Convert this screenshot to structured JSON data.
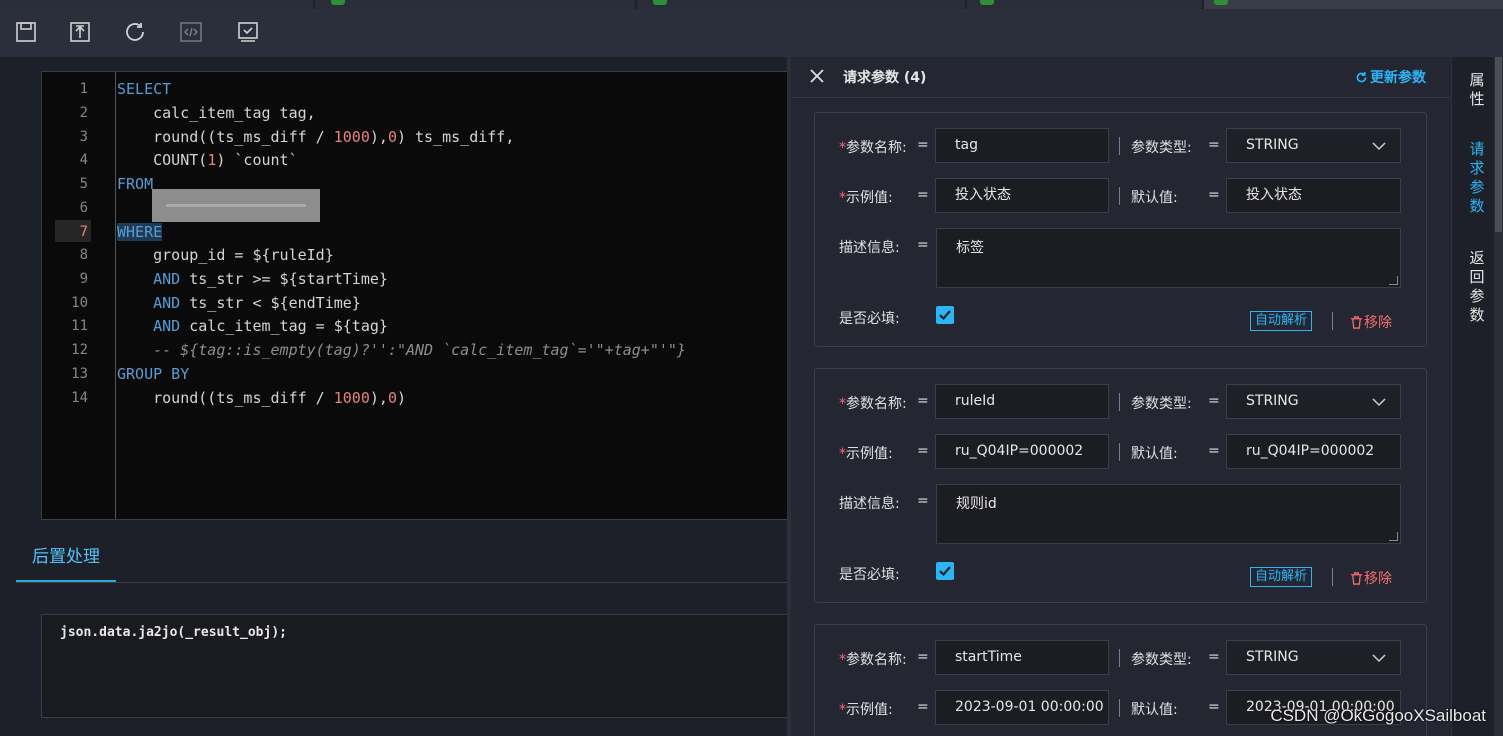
{
  "toolbar": {
    "buttons": [
      {
        "name": "save-icon"
      },
      {
        "name": "export-icon"
      },
      {
        "name": "refresh-icon"
      },
      {
        "name": "code-icon"
      },
      {
        "name": "checklist-icon"
      }
    ]
  },
  "editor": {
    "line_numbers": [
      "1",
      "2",
      "3",
      "4",
      "5",
      "6",
      "7",
      "8",
      "9",
      "10",
      "11",
      "12",
      "13",
      "14"
    ],
    "current_line": "7",
    "lines": {
      "l1": "SELECT",
      "l2": "    calc_item_tag tag,",
      "l3a": "    round((ts_ms_diff / ",
      "l3n1": "1000",
      "l3b": "),",
      "l3n2": "0",
      "l3c": ") ts_ms_diff,",
      "l4a": "    COUNT(",
      "l4n": "1",
      "l4b": ") `count`",
      "l5": "FROM",
      "l7": "WHERE",
      "l8": "    group_id = ${ruleId}",
      "l9k": "AND",
      "l9": " ts_str >= ${startTime}",
      "l10k": "AND",
      "l10": " ts_str < ${endTime}",
      "l11k": "AND",
      "l11": " calc_item_tag = ${tag}",
      "l12": "    -- ${tag::is_empty(tag)?'':\"AND `calc_item_tag`='\"+tag+\"'\"}",
      "l13": "GROUP BY",
      "l14a": "    round((ts_ms_diff / ",
      "l14n1": "1000",
      "l14b": "),",
      "l14n2": "0",
      "l14c": ")"
    }
  },
  "post": {
    "tab_label": "后置处理",
    "code": "json.data.ja2jo(_result_obj);"
  },
  "panel": {
    "title": "请求参数 (4)",
    "refresh_label": "更新参数",
    "labels": {
      "param_name": "参数名称:",
      "param_type": "参数类型:",
      "example": "示例值:",
      "default": "默认值:",
      "desc": "描述信息:",
      "required": "是否必填:",
      "eq": "=",
      "req_mark": "*",
      "auto_parse": "自动解析",
      "remove": "移除"
    },
    "params": [
      {
        "name": "tag",
        "type": "STRING",
        "example": "投入状态",
        "default": "投入状态",
        "desc": "标签",
        "required": true
      },
      {
        "name": "ruleId",
        "type": "STRING",
        "example": "ru_Q04IP=000002",
        "default": "ru_Q04IP=000002",
        "desc": "规则id",
        "required": true
      },
      {
        "name": "startTime",
        "type": "STRING",
        "example": "2023-09-01 00:00:00",
        "default": "2023-09-01 00:00:00",
        "desc": "",
        "required": true
      }
    ]
  },
  "rightnav": {
    "items": [
      {
        "label": "属性",
        "chars": [
          "属",
          "性"
        ]
      },
      {
        "label": "请求参数",
        "chars": [
          "请",
          "求",
          "参",
          "数"
        ]
      },
      {
        "label": "返回参数",
        "chars": [
          "返",
          "回",
          "参",
          "数"
        ]
      }
    ]
  },
  "watermark": "CSDN @OkGogooXSailboat",
  "colors": {
    "accent": "#29b6f6",
    "danger": "#f56c6c",
    "keyword": "#569cd6",
    "number": "#e9817b"
  }
}
